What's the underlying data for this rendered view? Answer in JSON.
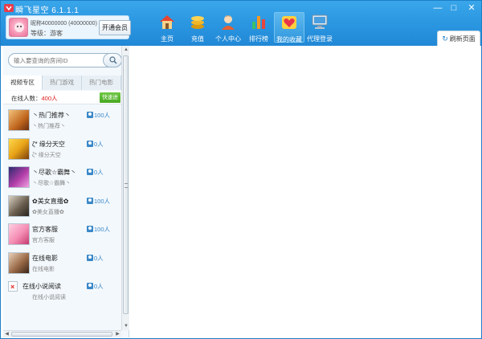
{
  "window": {
    "title": "瞬飞星空  6.1.1.1",
    "controls": [
      "—",
      "□",
      "✕"
    ]
  },
  "user": {
    "id_text": "昵称40000000 (40000000)",
    "level_text": "等级：游客",
    "vip_button": "开通会员"
  },
  "nav": [
    {
      "label": "主页",
      "icon": "home-icon"
    },
    {
      "label": "充值",
      "icon": "coins-icon"
    },
    {
      "label": "个人中心",
      "icon": "user-center-icon"
    },
    {
      "label": "排行榜",
      "icon": "ranking-icon"
    },
    {
      "label": "我的收藏",
      "icon": "favorites-icon"
    },
    {
      "label": "代理登录",
      "icon": "monitor-icon"
    }
  ],
  "refresh_tab": {
    "label": "刷新页面",
    "icon": "refresh-icon"
  },
  "search": {
    "placeholder": "输入要查询的房间ID",
    "icon": "search-icon"
  },
  "tabs": [
    "视频专区",
    "热门游戏",
    "热门电影"
  ],
  "online": {
    "label": "在线人数：",
    "count": "400人",
    "quick_button": "快速进"
  },
  "rooms": [
    {
      "name": "丶热门推荐丶",
      "sub": "丶热门推荐丶",
      "count": "100人"
    },
    {
      "name": "ζ* 缘分天空",
      "sub": "ζ* 缘分天空",
      "count": "0人"
    },
    {
      "name": "丶尽歌☆霸舞丶",
      "sub": "丶尽歌☆霸舞丶",
      "count": "0人"
    },
    {
      "name": "✿美女直播✿",
      "sub": "✿美女直播✿",
      "count": "100人"
    },
    {
      "name": "官方客服",
      "sub": "官方客服",
      "count": "100人"
    },
    {
      "name": "在线电影",
      "sub": "在线电影",
      "count": "0人"
    },
    {
      "name": "在线小说阅读",
      "sub": "在线小说阅读",
      "count": "0人"
    }
  ],
  "colors": {
    "accent": "#2a93dd",
    "count_red": "#e02020",
    "quick_green": "#52b22c"
  }
}
